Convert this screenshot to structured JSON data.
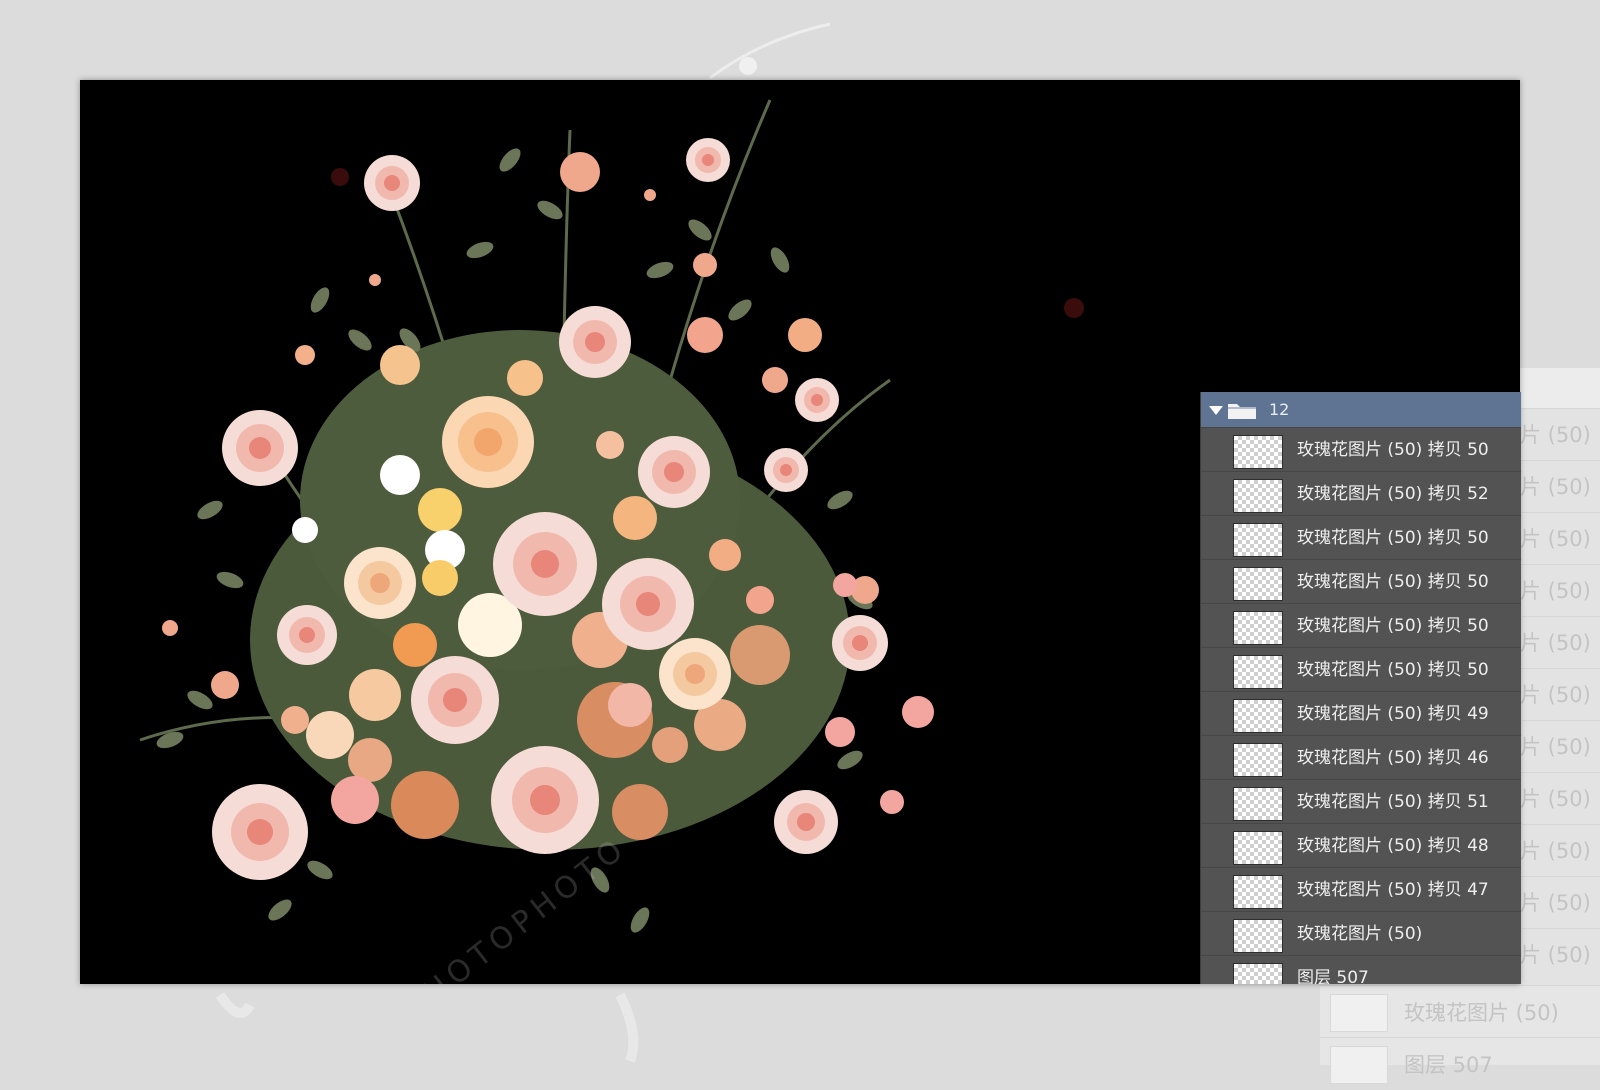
{
  "layers_panel": {
    "group_name": "12",
    "layers": [
      {
        "name": "玫瑰花图片 (50) 拷贝 50"
      },
      {
        "name": "玫瑰花图片 (50) 拷贝 52"
      },
      {
        "name": "玫瑰花图片 (50) 拷贝 50"
      },
      {
        "name": "玫瑰花图片 (50) 拷贝 50"
      },
      {
        "name": "玫瑰花图片 (50) 拷贝 50"
      },
      {
        "name": "玫瑰花图片 (50) 拷贝 50"
      },
      {
        "name": "玫瑰花图片 (50) 拷贝 49"
      },
      {
        "name": "玫瑰花图片 (50) 拷贝 46"
      },
      {
        "name": "玫瑰花图片 (50) 拷贝 51"
      },
      {
        "name": "玫瑰花图片 (50) 拷贝 48"
      },
      {
        "name": "玫瑰花图片 (50) 拷贝 47"
      },
      {
        "name": "玫瑰花图片 (50)"
      },
      {
        "name": "图层 507"
      }
    ]
  },
  "background_echo": {
    "row_fragment": "片 (50)",
    "bottom_rows": [
      "玫瑰花图片 (50)",
      "图层 507"
    ]
  },
  "watermark": {
    "text": "PHOTOPHOTO"
  },
  "colors": {
    "canvas": "#000000",
    "panel": "#535353",
    "group_header": "#5f7392",
    "leaf": "#6b7558",
    "rose": "#f3c7bf",
    "peach": "#f0b089"
  }
}
